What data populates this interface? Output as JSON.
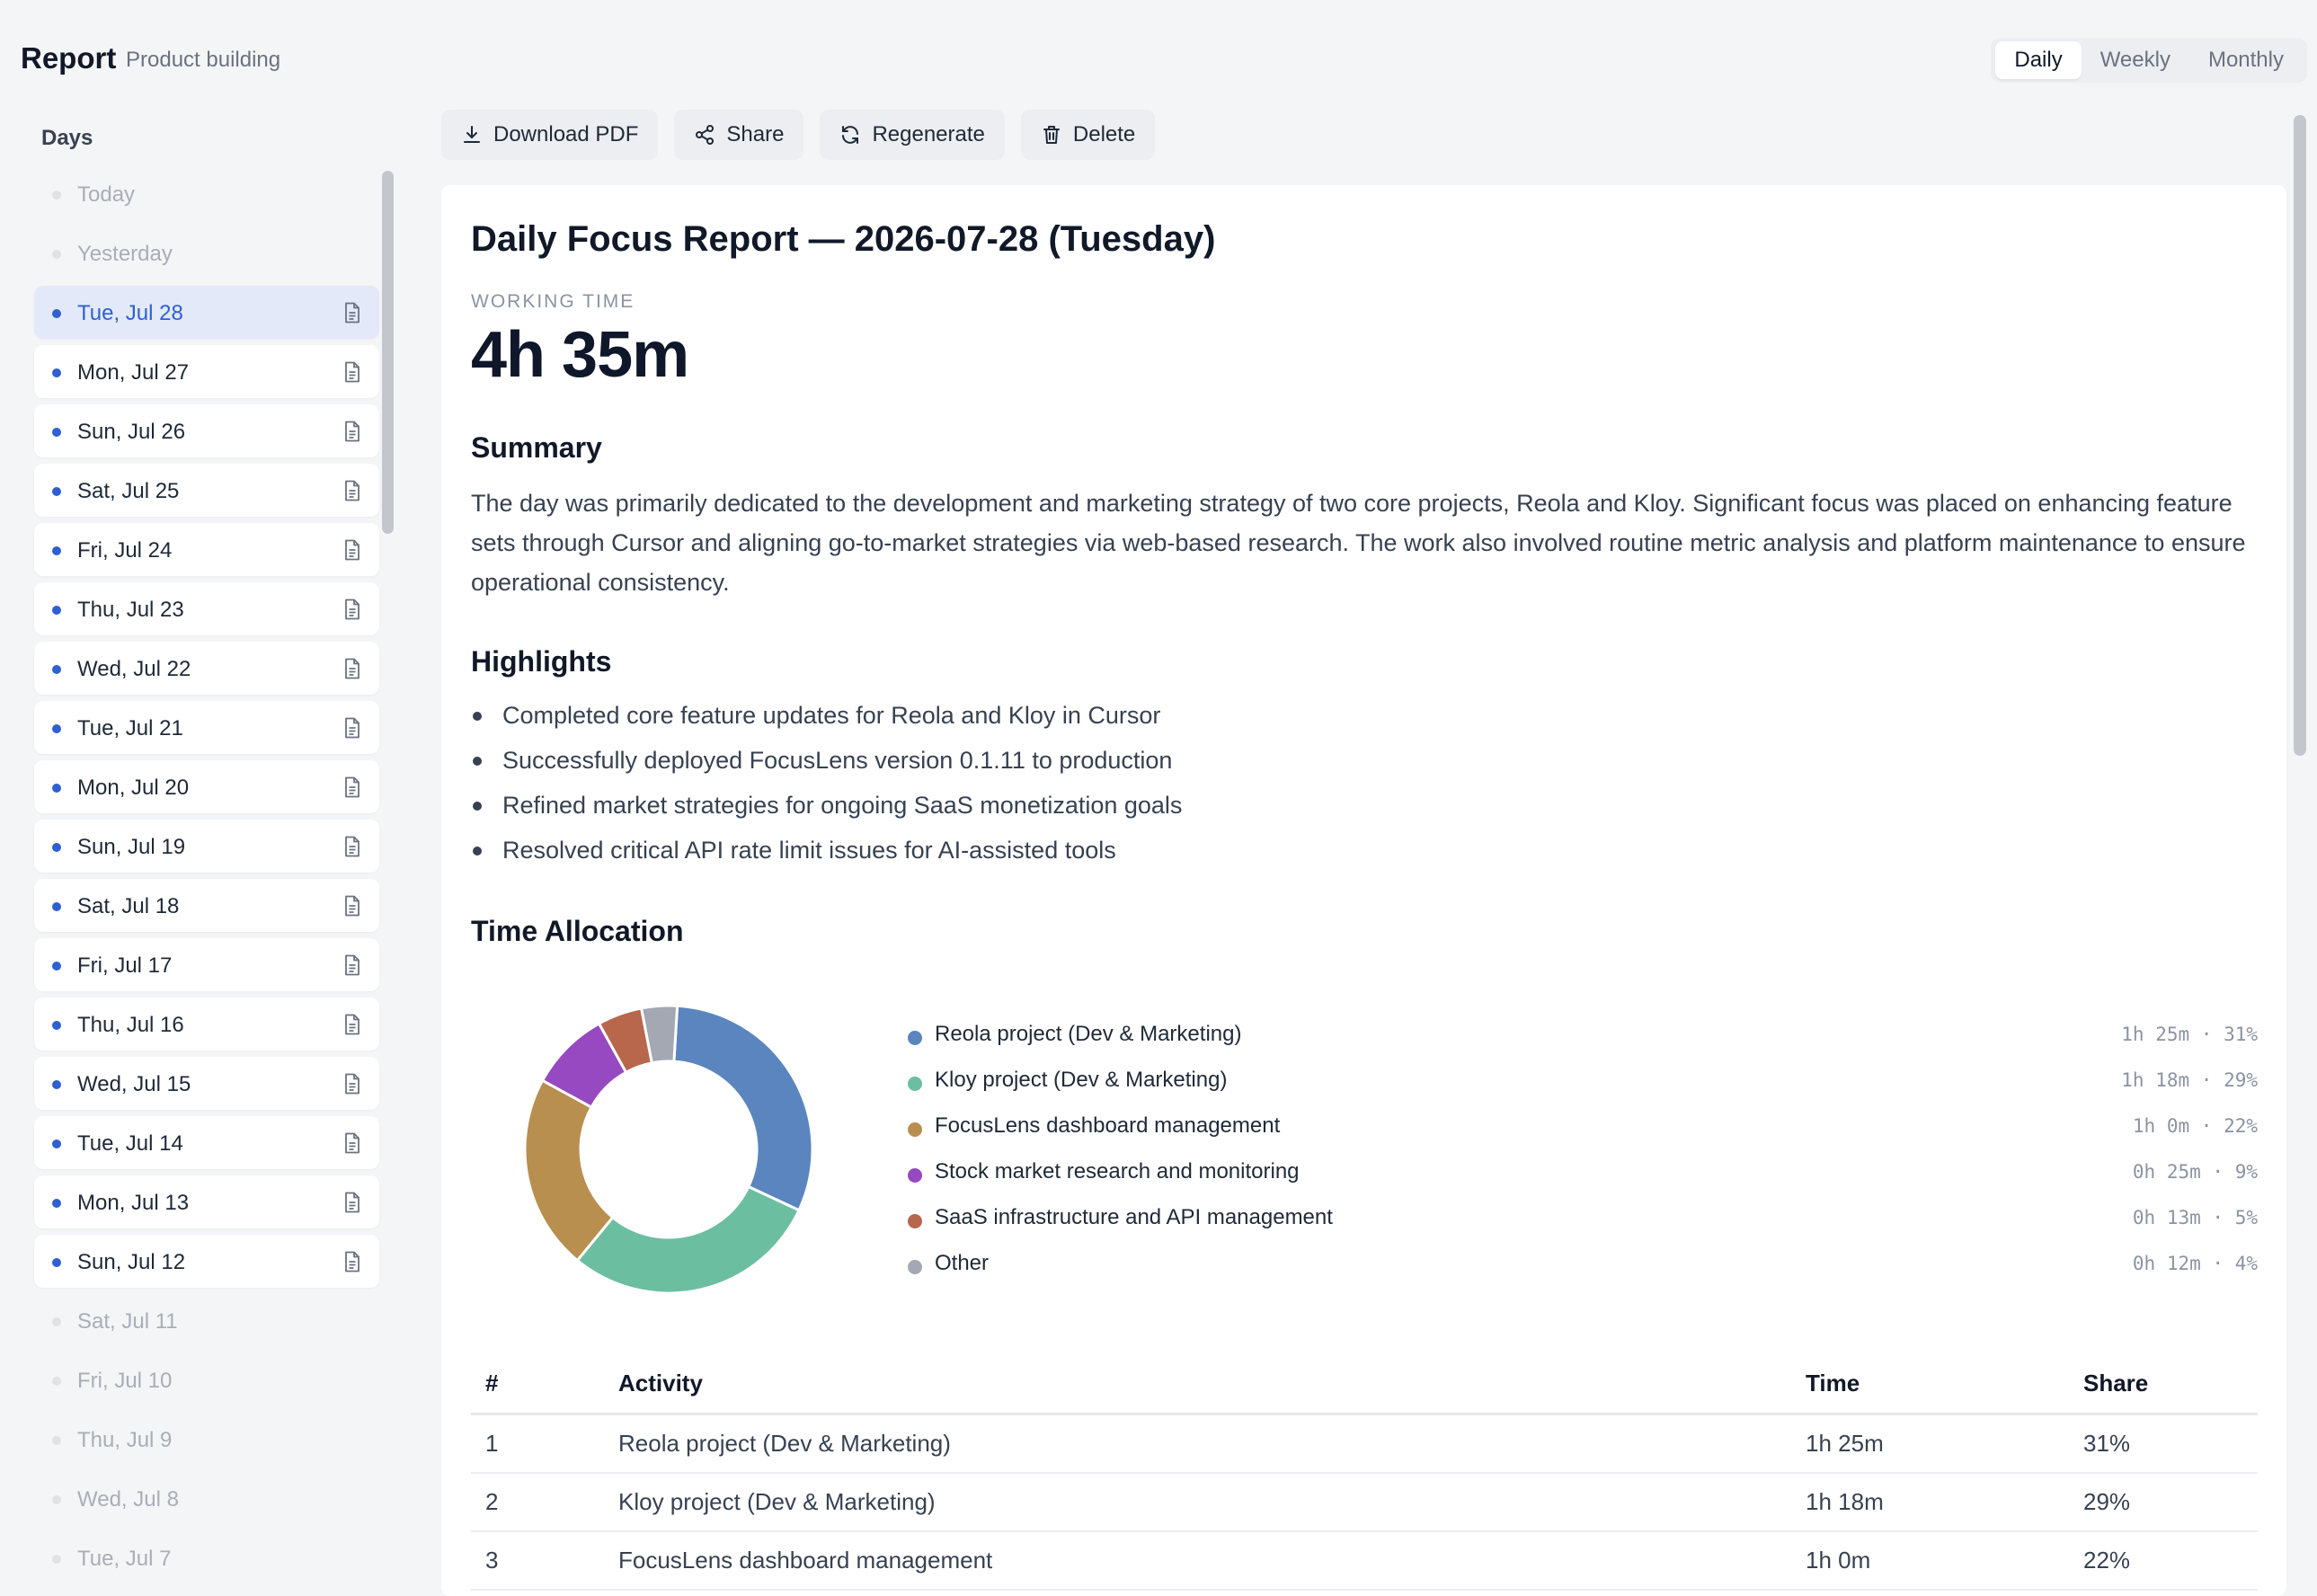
{
  "header": {
    "title": "Report",
    "subtitle": "Product building",
    "ranges": [
      {
        "label": "Daily",
        "active": true
      },
      {
        "label": "Weekly",
        "active": false
      },
      {
        "label": "Monthly",
        "active": false
      }
    ]
  },
  "sidebar": {
    "title": "Days",
    "days": [
      {
        "label": "Today",
        "has_report": false,
        "selected": false
      },
      {
        "label": "Yesterday",
        "has_report": false,
        "selected": false
      },
      {
        "label": "Tue, Jul 28",
        "has_report": true,
        "selected": true
      },
      {
        "label": "Mon, Jul 27",
        "has_report": true,
        "selected": false
      },
      {
        "label": "Sun, Jul 26",
        "has_report": true,
        "selected": false
      },
      {
        "label": "Sat, Jul 25",
        "has_report": true,
        "selected": false
      },
      {
        "label": "Fri, Jul 24",
        "has_report": true,
        "selected": false
      },
      {
        "label": "Thu, Jul 23",
        "has_report": true,
        "selected": false
      },
      {
        "label": "Wed, Jul 22",
        "has_report": true,
        "selected": false
      },
      {
        "label": "Tue, Jul 21",
        "has_report": true,
        "selected": false
      },
      {
        "label": "Mon, Jul 20",
        "has_report": true,
        "selected": false
      },
      {
        "label": "Sun, Jul 19",
        "has_report": true,
        "selected": false
      },
      {
        "label": "Sat, Jul 18",
        "has_report": true,
        "selected": false
      },
      {
        "label": "Fri, Jul 17",
        "has_report": true,
        "selected": false
      },
      {
        "label": "Thu, Jul 16",
        "has_report": true,
        "selected": false
      },
      {
        "label": "Wed, Jul 15",
        "has_report": true,
        "selected": false
      },
      {
        "label": "Tue, Jul 14",
        "has_report": true,
        "selected": false
      },
      {
        "label": "Mon, Jul 13",
        "has_report": true,
        "selected": false
      },
      {
        "label": "Sun, Jul 12",
        "has_report": true,
        "selected": false
      },
      {
        "label": "Sat, Jul 11",
        "has_report": false,
        "selected": false
      },
      {
        "label": "Fri, Jul 10",
        "has_report": false,
        "selected": false
      },
      {
        "label": "Thu, Jul 9",
        "has_report": false,
        "selected": false
      },
      {
        "label": "Wed, Jul 8",
        "has_report": false,
        "selected": false
      },
      {
        "label": "Tue, Jul 7",
        "has_report": false,
        "selected": false
      }
    ]
  },
  "toolbar": {
    "download_label": "Download PDF",
    "share_label": "Share",
    "regenerate_label": "Regenerate",
    "delete_label": "Delete"
  },
  "report": {
    "title": "Daily Focus Report — 2026-07-28 (Tuesday)",
    "working_time_label": "WORKING TIME",
    "working_time_value": "4h 35m",
    "summary_heading": "Summary",
    "summary_text": "The day was primarily dedicated to the development and marketing strategy of two core projects, Reola and Kloy. Significant focus was placed on enhancing feature sets through Cursor and aligning go-to-market strategies via web-based research. The work also involved routine metric analysis and platform maintenance to ensure operational consistency.",
    "highlights_heading": "Highlights",
    "highlights": [
      "Completed core feature updates for Reola and Kloy in Cursor",
      "Successfully deployed FocusLens version 0.1.11 to production",
      "Refined market strategies for ongoing SaaS monetization goals",
      "Resolved critical API rate limit issues for AI-assisted tools"
    ],
    "allocation_heading": "Time Allocation",
    "table_headers": {
      "num": "#",
      "activity": "Activity",
      "time": "Time",
      "share": "Share"
    },
    "table_rows": [
      {
        "num": "1",
        "activity": "Reola project (Dev & Marketing)",
        "time": "1h 25m",
        "share": "31%"
      },
      {
        "num": "2",
        "activity": "Kloy project (Dev & Marketing)",
        "time": "1h 18m",
        "share": "29%"
      },
      {
        "num": "3",
        "activity": "FocusLens dashboard management",
        "time": "1h 0m",
        "share": "22%"
      }
    ]
  },
  "chart_data": {
    "type": "pie",
    "variant": "donut",
    "slices": [
      {
        "label": "Reola project (Dev & Marketing)",
        "time": "1h 25m",
        "share": "31%",
        "value": 31,
        "color": "#5b85bf"
      },
      {
        "label": "Kloy project (Dev & Marketing)",
        "time": "1h 18m",
        "share": "29%",
        "value": 29,
        "color": "#6cbea0"
      },
      {
        "label": "FocusLens dashboard management",
        "time": "1h 0m",
        "share": "22%",
        "value": 22,
        "color": "#b88f4e"
      },
      {
        "label": "Stock market research and monitoring",
        "time": "0h 25m",
        "share": "9%",
        "value": 9,
        "color": "#9649c0"
      },
      {
        "label": "SaaS infrastructure and API management",
        "time": "0h 13m",
        "share": "5%",
        "value": 5,
        "color": "#b8664c"
      },
      {
        "label": "Other",
        "time": "0h 12m",
        "share": "4%",
        "value": 4,
        "color": "#a3a8b3"
      }
    ]
  }
}
